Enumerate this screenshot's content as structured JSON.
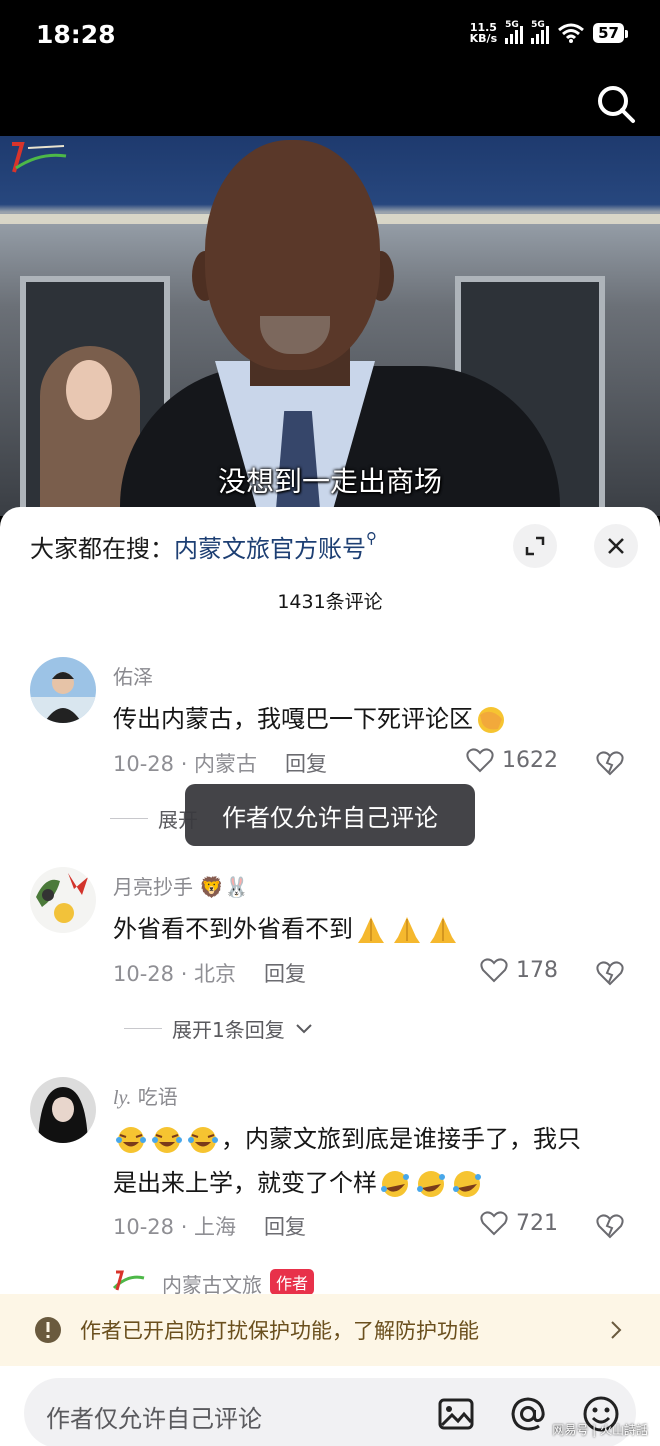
{
  "status_bar": {
    "time": "18:28",
    "net_speed_value": "11.5",
    "net_speed_unit": "KB/s",
    "sim1": "5G",
    "sim2": "5G",
    "battery": "57"
  },
  "video": {
    "subtitle": "没想到一走出商场",
    "search_icon": "search-icon"
  },
  "panel": {
    "hot_search_prefix": "大家都在搜：",
    "hot_search_link": "内蒙文旅官方账号",
    "comment_count": "1431条评论",
    "expand_icon": "expand-icon",
    "close_icon": "close-icon"
  },
  "comments": [
    {
      "name": "佑泽",
      "text": "传出内蒙古，我嘎巴一下死评论区",
      "date_location": "10-28 · 内蒙古",
      "reply": "回复",
      "likes": "1622",
      "expand": "展开"
    },
    {
      "name": "月亮抄手",
      "text": "外省看不到外省看不到",
      "date_location": "10-28 · 北京",
      "reply": "回复",
      "likes": "178",
      "expand": "展开1条回复"
    },
    {
      "name": "吃语",
      "name_prefix": "ly.",
      "text_line1": "，内蒙文旅到底是谁接手了，我只",
      "text_line2": "是出来上学，就变了个样",
      "date_location": "10-28 · 上海",
      "reply": "回复",
      "likes": "721"
    },
    {
      "name": "内蒙古文旅",
      "badge": "作者"
    }
  ],
  "toast": "作者仅允许自己评论",
  "notice": "作者已开启防打扰保护功能，了解防护功能",
  "input": {
    "placeholder": "作者仅允许自己评论"
  },
  "watermark": "网易号 | 火山詩話",
  "colors": {
    "link": "#1d3f73",
    "author_badge": "#e8314a",
    "notice_bg": "#fdf6e6"
  }
}
